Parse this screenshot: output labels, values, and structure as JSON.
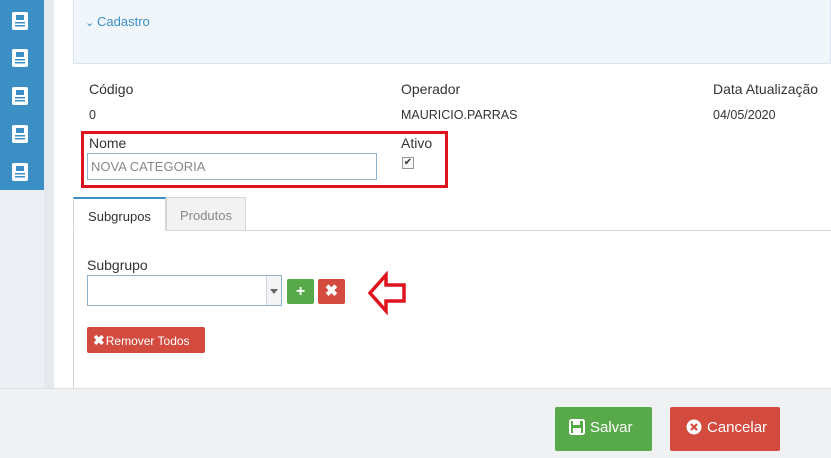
{
  "panel": {
    "title": "Cadastro"
  },
  "fields": {
    "codigo_label": "Código",
    "codigo_value": "0",
    "operador_label": "Operador",
    "operador_value": "MAURICIO.PARRAS",
    "data_label": "Data Atualização",
    "data_value": "04/05/2020",
    "nome_label": "Nome",
    "nome_value": "NOVA CATEGORIA",
    "ativo_label": "Ativo",
    "ativo_checked": "✔"
  },
  "tabs": [
    {
      "label": "Subgrupos",
      "active": true
    },
    {
      "label": "Produtos",
      "active": false
    }
  ],
  "subgrupo": {
    "label": "Subgrupo",
    "add_label": "+",
    "remove_label": "✖",
    "remove_all_label": "Remover Todos"
  },
  "footer": {
    "save_label": "Salvar",
    "cancel_label": "Cancelar"
  },
  "colors": {
    "sidebar": "#3b8fc5",
    "success": "#58a94a",
    "danger": "#d24b3e",
    "highlight": "#e0141e"
  },
  "sidebar_icons": [
    "document-icon",
    "document-icon",
    "document-icon",
    "document-icon",
    "document-icon"
  ]
}
